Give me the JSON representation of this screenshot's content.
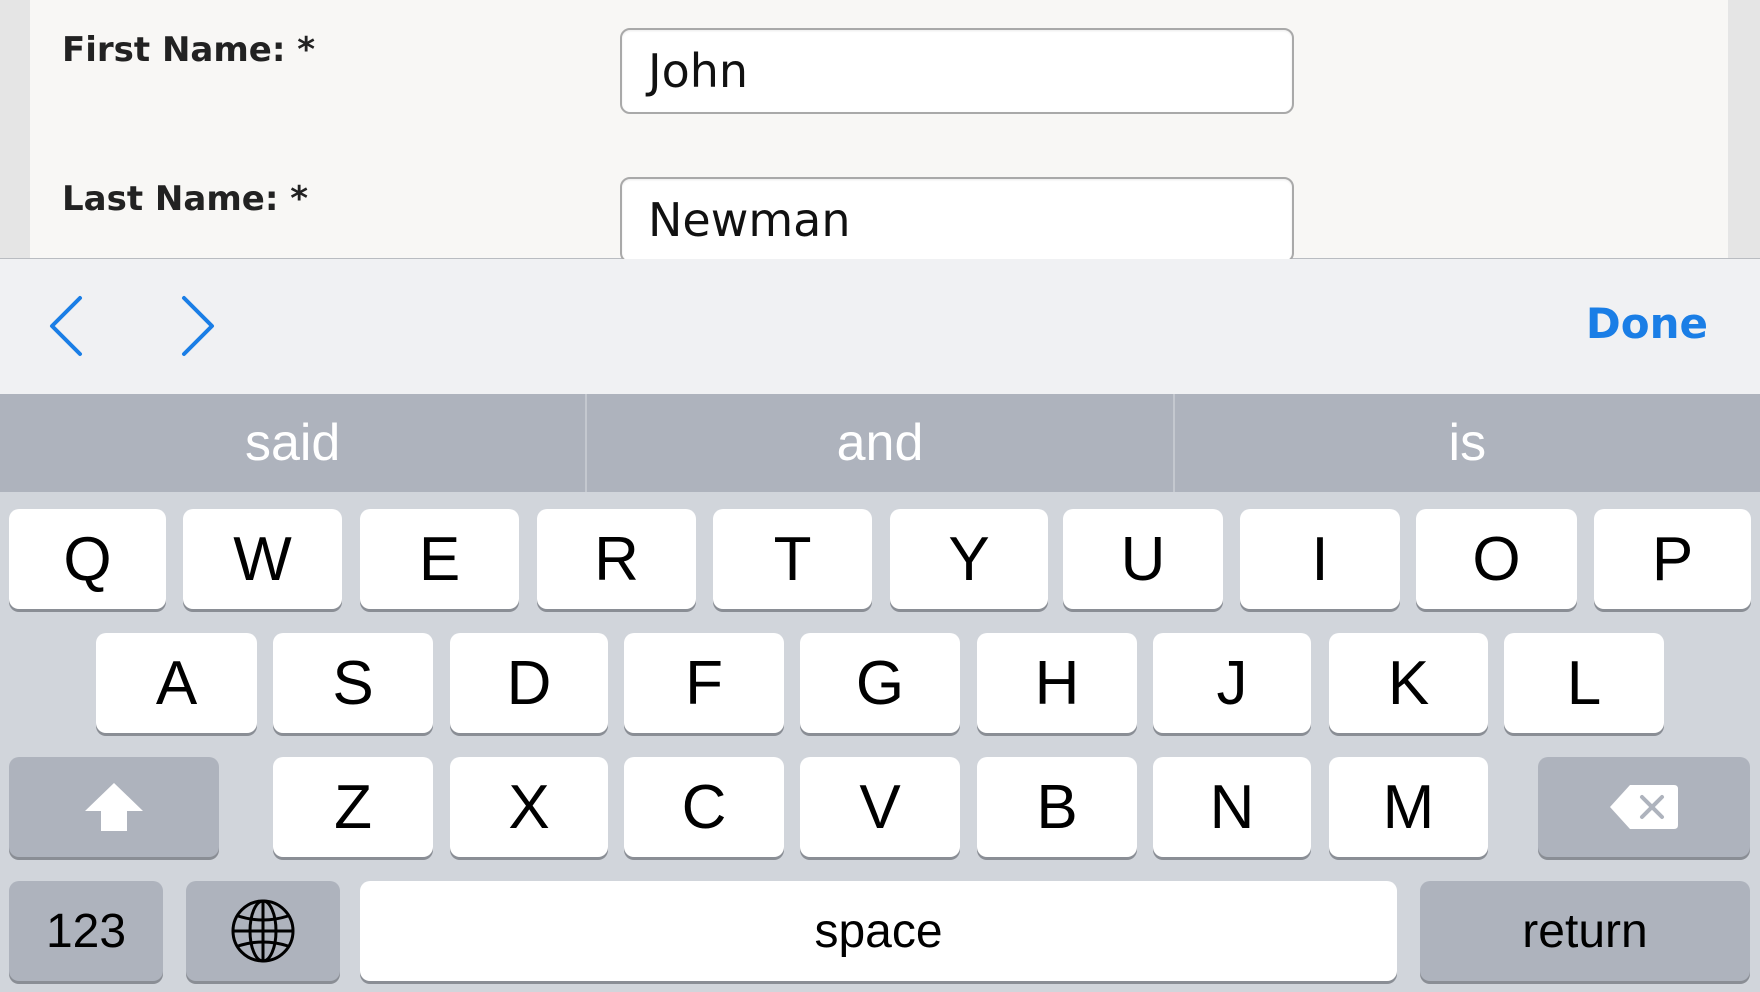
{
  "form": {
    "first_name_label": "First Name: *",
    "first_name_value": "John",
    "last_name_label": "Last Name: *",
    "last_name_value": "Newman"
  },
  "toolbar": {
    "prev_icon": "chevron-left-icon",
    "next_icon": "chevron-right-icon",
    "done_label": "Done",
    "accent_color": "#1a7ee6"
  },
  "predictive": {
    "items": [
      "said",
      "and",
      "is"
    ]
  },
  "keyboard": {
    "row1": [
      "Q",
      "W",
      "E",
      "R",
      "T",
      "Y",
      "U",
      "I",
      "O",
      "P"
    ],
    "row2": [
      "A",
      "S",
      "D",
      "F",
      "G",
      "H",
      "J",
      "K",
      "L"
    ],
    "row3": [
      "Z",
      "X",
      "C",
      "V",
      "B",
      "N",
      "M"
    ],
    "shift_icon": "shift-arrow-icon",
    "delete_icon": "backspace-icon",
    "numbers_label": "123",
    "globe_icon": "globe-icon",
    "space_label": "space",
    "return_label": "return"
  }
}
